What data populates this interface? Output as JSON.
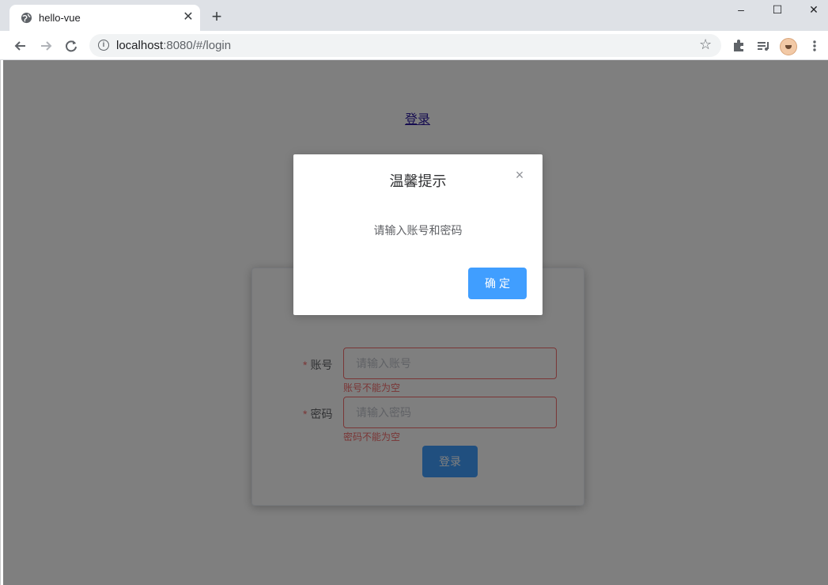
{
  "browser": {
    "tab_title": "hello-vue",
    "url_host": "localhost",
    "url_rest": ":8080/#/login",
    "new_tab_glyph": "+",
    "tab_close_glyph": "✕",
    "window_minimize_glyph": "–",
    "window_maximize_glyph": "☐",
    "window_close_glyph": "✕",
    "icons": [
      "globe-icon",
      "back-arrow-icon",
      "forward-arrow-icon",
      "reload-icon",
      "info-icon",
      "star-icon",
      "extensions-icon",
      "media-queue-icon",
      "avatar",
      "more-menu-icon"
    ]
  },
  "page": {
    "header_link": "登录",
    "form": {
      "account_label": "账号",
      "account_placeholder": "请输入账号",
      "account_error": "账号不能为空",
      "password_label": "密码",
      "password_placeholder": "请输入密码",
      "password_error": "密码不能为空",
      "required_mark": "*",
      "submit_label": "登录"
    }
  },
  "dialog": {
    "title": "温馨提示",
    "message": "请输入账号和密码",
    "confirm_label": "确定",
    "close_glyph": "×"
  },
  "colors": {
    "primary": "#409eff",
    "error": "#f56c6c",
    "mask": "rgba(0,0,0,0.5)"
  }
}
